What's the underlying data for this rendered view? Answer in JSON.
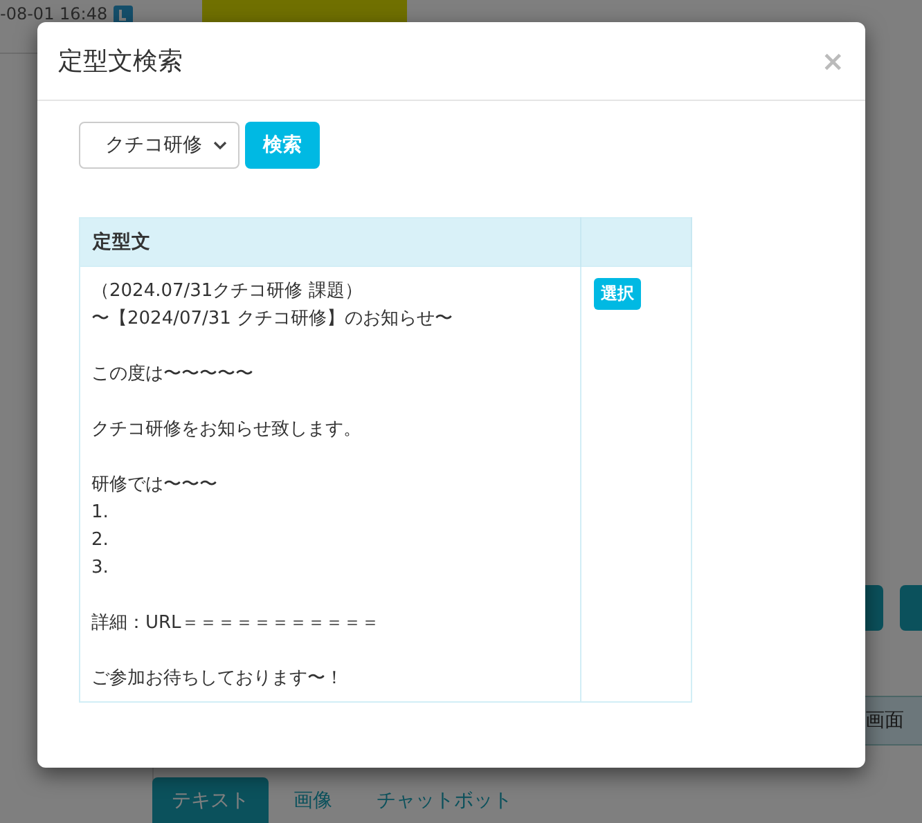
{
  "background": {
    "timestamp": "-08-01 16:48",
    "side_panel_text": "画面",
    "tabs": [
      {
        "label": "テキスト",
        "selected": true
      },
      {
        "label": "画像",
        "selected": false
      },
      {
        "label": "チャットボット",
        "selected": false
      }
    ]
  },
  "modal": {
    "title": "定型文検索",
    "close": "×",
    "select": {
      "value": "クチコ研修"
    },
    "search_button": "検索",
    "table": {
      "columns": [
        "定型文"
      ],
      "rows": [
        {
          "paragraphs": [
            [
              "（2024.07/31クチコ研修 課題）",
              "〜【2024/07/31 クチコ研修】のお知らせ〜"
            ],
            [
              "この度は〜〜〜〜〜"
            ],
            [
              "クチコ研修をお知らせ致します。"
            ],
            [
              "研修では〜〜〜",
              "1.",
              "2.",
              "3."
            ],
            [
              "詳細：URL＝＝＝＝＝＝＝＝＝＝＝"
            ],
            [
              "ご参加お待ちしております〜！"
            ]
          ],
          "action": "選択"
        }
      ]
    }
  }
}
